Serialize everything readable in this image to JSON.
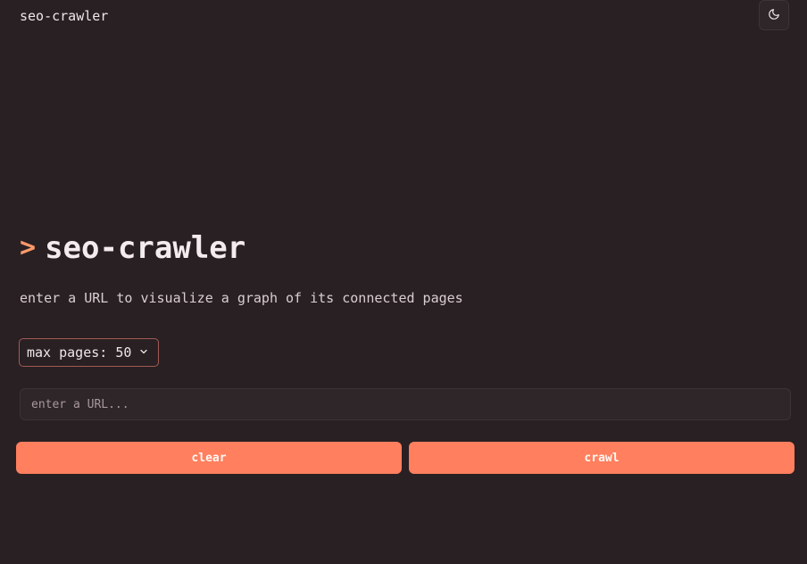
{
  "header": {
    "brand": "seo-crawler",
    "theme_toggle_icon": "moon-icon"
  },
  "hero": {
    "prompt": ">",
    "title": "seo-crawler",
    "subtitle": "enter a URL to visualize a graph of its connected pages"
  },
  "controls": {
    "max_pages_label": "max pages: 50",
    "max_pages_value": 50,
    "url_placeholder": "enter a URL...",
    "url_value": "",
    "clear_label": "clear",
    "crawl_label": "crawl"
  },
  "colors": {
    "background": "#292023",
    "accent": "#ff7f5e",
    "prompt": "#ff9a6a",
    "select_border": "#a15a55"
  }
}
